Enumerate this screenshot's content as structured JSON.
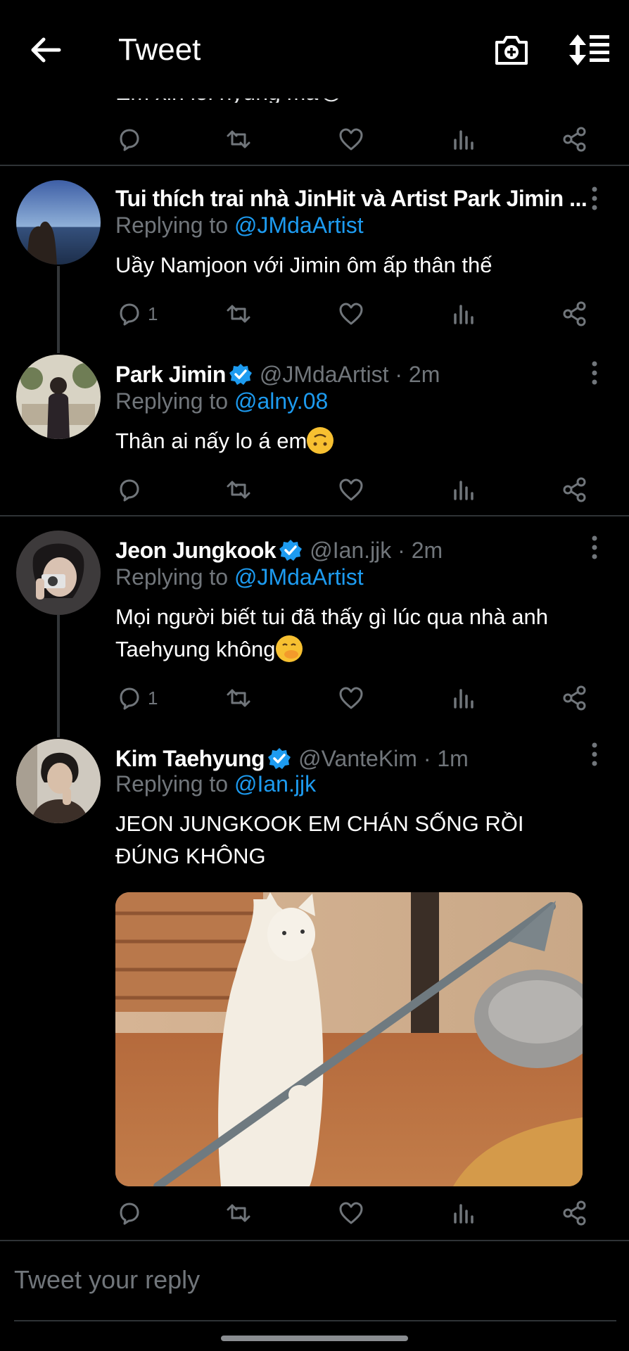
{
  "header": {
    "title": "Tweet"
  },
  "previous_tweet": {
    "cut_text": "Em xin lỗi hyung mà😭"
  },
  "tweets": [
    {
      "name": "Tui thích trai nhà JinHit và Artist Park Jimin ...",
      "verified": false,
      "handle": "",
      "reply_prefix": "Replying to ",
      "reply_to": "@JMdaArtist",
      "text": "Uầy Namjoon với Jimin ôm ấp thân thế",
      "reply_count": "1"
    },
    {
      "name": "Park Jimin",
      "verified": true,
      "handle": "@JMdaArtist · 2m",
      "reply_prefix": "Replying to ",
      "reply_to": "@alny.08",
      "text": "Thân ai nấy lo á em",
      "reply_count": ""
    },
    {
      "name": "Jeon Jungkook",
      "verified": true,
      "handle": "@Ian.jjk · 2m",
      "reply_prefix": "Replying to ",
      "reply_to": "@JMdaArtist",
      "text": "Mọi người biết tui đã thấy gì lúc qua nhà anh Taehyung không",
      "reply_count": "1"
    },
    {
      "name": "Kim Taehyung",
      "verified": true,
      "handle": "@VanteKim · 1m",
      "reply_prefix": "Replying to ",
      "reply_to": "@Ian.jjk",
      "text": "JEON JUNGKOOK EM CHÁN SỐNG RỒI ĐÚNG KHÔNG",
      "reply_count": "",
      "has_media": true
    }
  ],
  "reply_box": {
    "placeholder": "Tweet your reply"
  },
  "icons": {
    "back": "arrow-left-icon",
    "camera": "camera-plus-icon",
    "sort": "sort-icon",
    "reply": "comment-icon",
    "retweet": "retweet-icon",
    "like": "heart-icon",
    "views": "analytics-icon",
    "share": "share-icon",
    "verified": "verified-badge-icon",
    "more": "more-vertical-icon"
  },
  "colors": {
    "background": "#000000",
    "text": "#ffffff",
    "muted": "#71767b",
    "accent": "#1d9bf0",
    "divider": "#2f3336"
  }
}
